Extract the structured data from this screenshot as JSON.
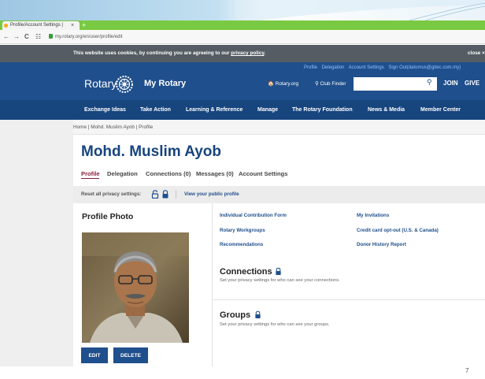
{
  "browser": {
    "tab_title": "Profile/Account Settings |",
    "tab_close": "×",
    "new_tab": "+",
    "nav_back": "←",
    "nav_forward": "→",
    "nav_reload": "C",
    "nav_apps": "☷",
    "url": "my.rotary.org/en/user/profile/edit"
  },
  "cookie_bar": {
    "text": "This website uses cookies, by continuing you are agreeing to our ",
    "link": "privacy policy",
    "text_end": ".",
    "close": "close ×"
  },
  "header": {
    "util_links": [
      "Profile",
      "Delegation",
      "Account Settings",
      "Sign Out(datomus@gitec.com.my)"
    ],
    "logo_text": "Rotary",
    "my_rotary": "My Rotary",
    "rotary_org": "🏠 Rotary.org",
    "club_finder": "⚲ Club Finder",
    "search_placeholder": "",
    "search_icon": "search-icon",
    "join": "JOIN",
    "give": "GIVE",
    "accent": "#1f4f8c",
    "nav_bg": "#17457e"
  },
  "nav": [
    "Exchange Ideas",
    "Take Action",
    "Learning & Reference",
    "Manage",
    "The Rotary Foundation",
    "News & Media",
    "Member Center"
  ],
  "page": {
    "breadcrumb": "Home | Mohd. Muslim Ayob | Profile",
    "title": "Mohd. Muslim Ayob",
    "tabs": [
      "Profile",
      "Delegation",
      "Connections (0)",
      "Messages (0)",
      "Account Settings"
    ],
    "privacy_label": "Reset all privacy settings:",
    "public_link": "View your public profile",
    "photo_title": "Profile Photo",
    "edit_label": "EDIT",
    "delete_label": "DELETE",
    "quick_links": [
      "Individual Contribution Form",
      "My Invitations",
      "Rotary Workgroups",
      "Credit card opt-out (U.S. & Canada)",
      "Recommendations",
      "Donor History Report"
    ],
    "connections_title": "Connections",
    "connections_desc": "Set your privacy settings for who can see your connections.",
    "groups_title": "Groups",
    "groups_desc": "Set your privacy settings for who can see your groups.",
    "active_tab_color": "#8b1e3f"
  },
  "slide_number": "7"
}
